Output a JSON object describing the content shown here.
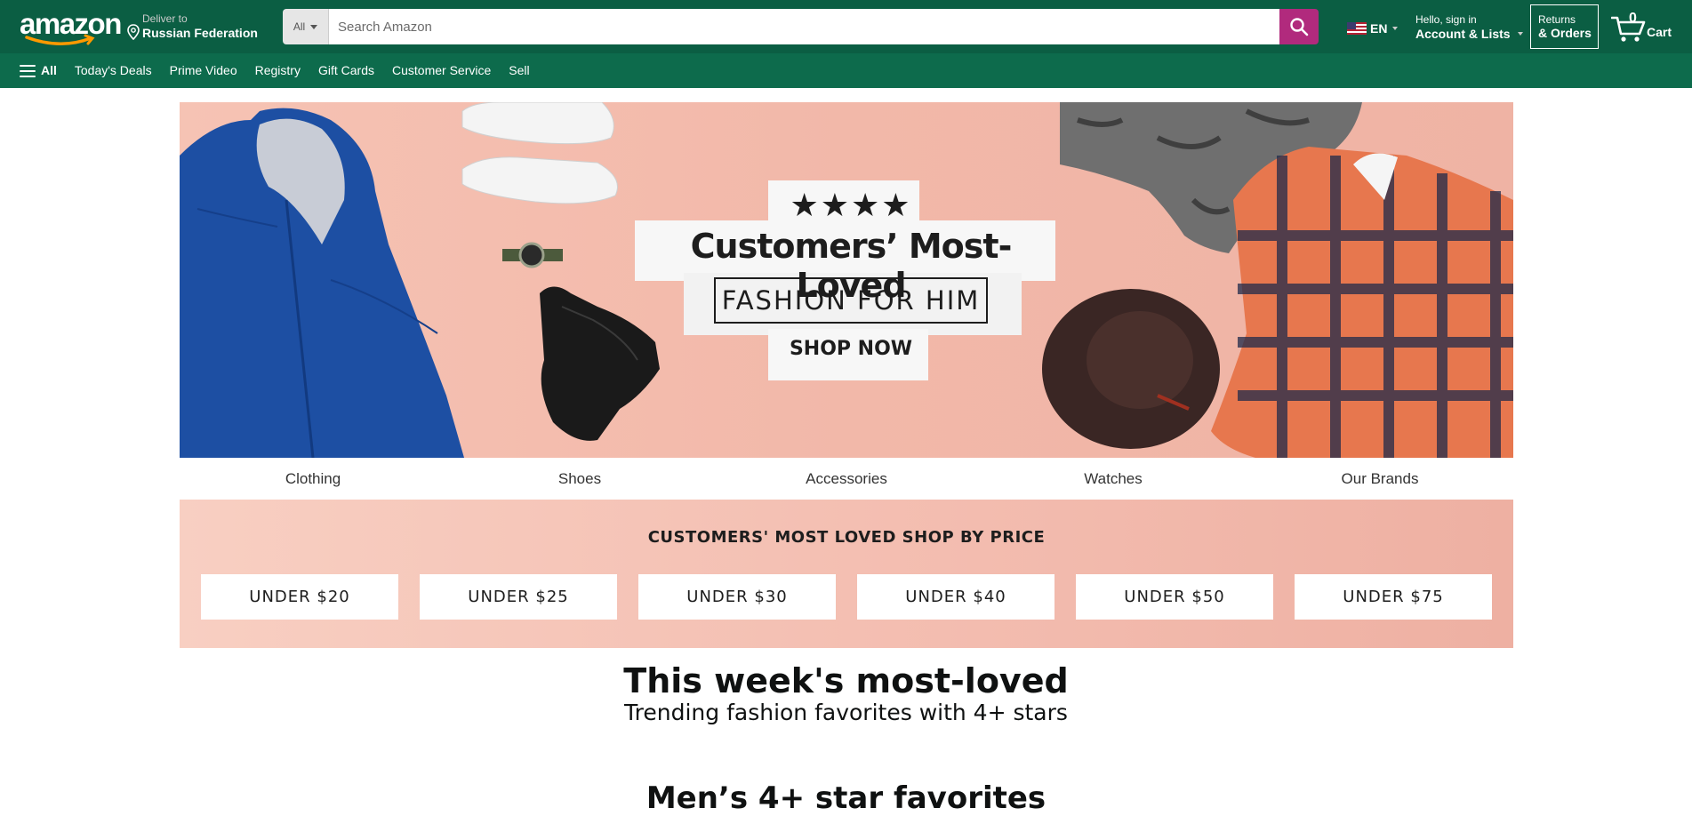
{
  "nav": {
    "logo": "amazon",
    "deliver_small": "Deliver to",
    "deliver_big": "Russian Federation",
    "search_category": "All",
    "search_placeholder": "Search Amazon",
    "language": "EN",
    "account_small": "Hello, sign in",
    "account_big": "Account & Lists",
    "returns_small": "Returns",
    "returns_big": "& Orders",
    "cart_count": "0",
    "cart_label": "Cart"
  },
  "subnav": {
    "all_label": "All",
    "items": [
      "Today's Deals",
      "Prime Video",
      "Registry",
      "Gift Cards",
      "Customer Service",
      "Sell"
    ]
  },
  "hero": {
    "stars": "★★★★",
    "title": "Customers’ Most-Loved",
    "subtitle": "FASHION FOR HIM",
    "cta": "SHOP NOW"
  },
  "categories": [
    "Clothing",
    "Shoes",
    "Accessories",
    "Watches",
    "Our Brands"
  ],
  "price_band": {
    "title": "CUSTOMERS' MOST LOVED SHOP BY PRICE",
    "buttons": [
      "UNDER $20",
      "UNDER $25",
      "UNDER $30",
      "UNDER $40",
      "UNDER $50",
      "UNDER $75"
    ]
  },
  "sections": {
    "week_title": "This week's most-loved",
    "week_subtitle": "Trending fashion favorites with 4+ stars",
    "men_title": "Men’s 4+ star favorites"
  },
  "colors": {
    "nav_top": "#0b5e43",
    "nav_sub": "#0d6b4c",
    "search_button": "#b12a7d",
    "hero_bg": "#f2b8a9"
  }
}
